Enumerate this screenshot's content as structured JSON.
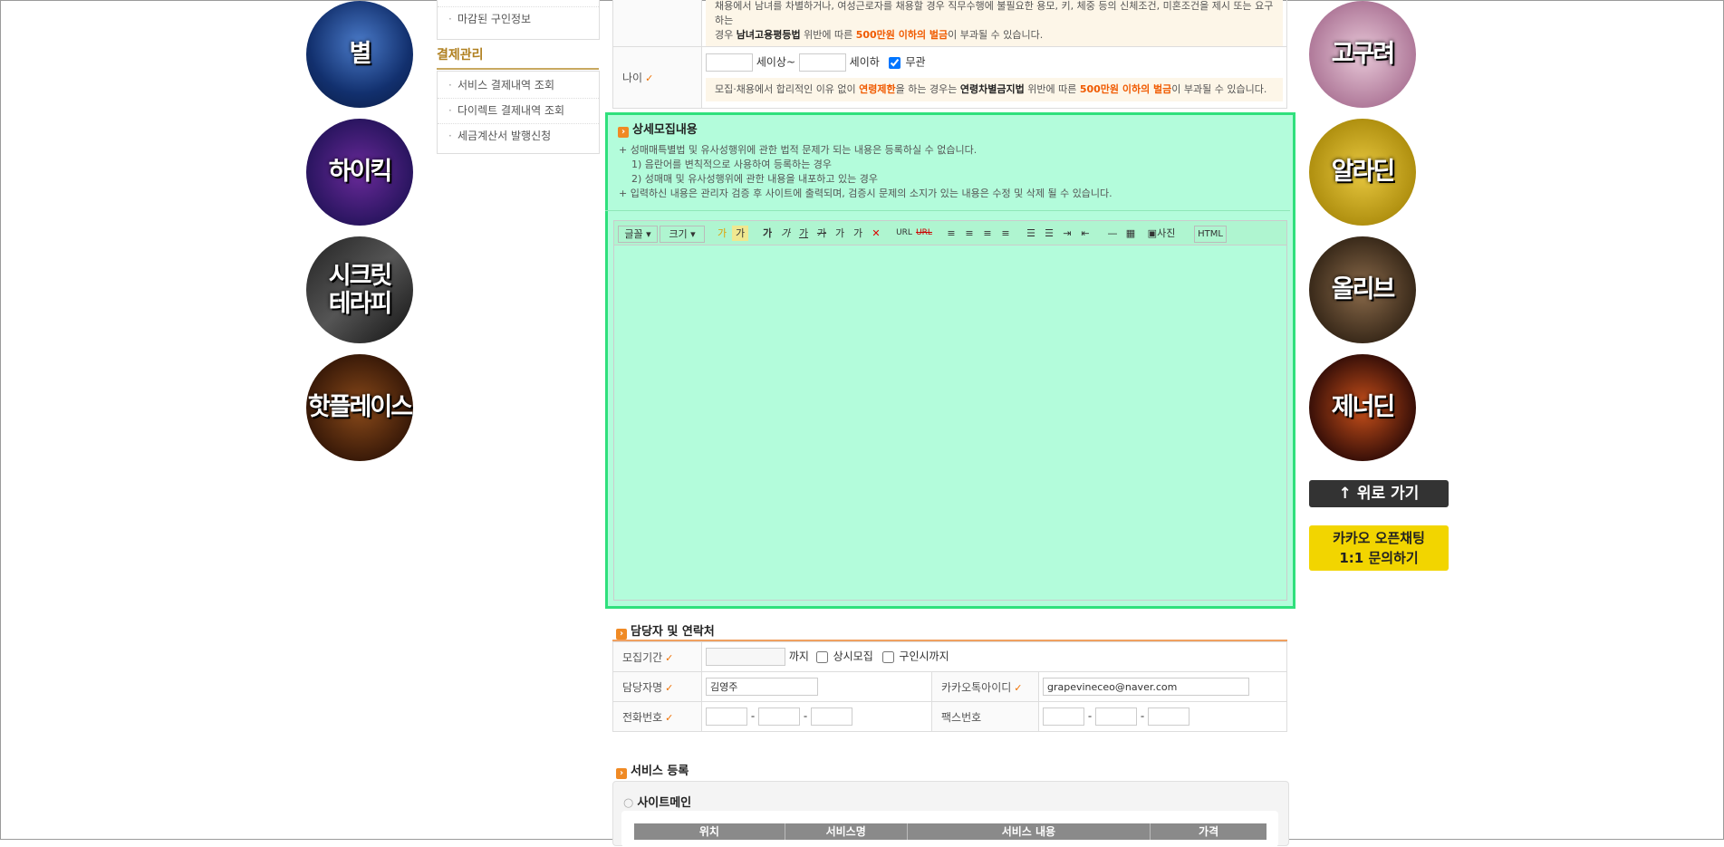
{
  "left_banners": [
    {
      "label": "별",
      "icon": "disco-ball-icon"
    },
    {
      "label": "하이킥",
      "icon": "balloon-icon"
    },
    {
      "label": "시크릿\n테라피",
      "icon": "massage-icon"
    },
    {
      "label": "핫플레이스",
      "icon": "bar-icon"
    }
  ],
  "right_banners": [
    {
      "label": "고구려",
      "icon": "champagne-tower-icon"
    },
    {
      "label": "알라딘",
      "icon": "wine-bottle-icon"
    },
    {
      "label": "올리브",
      "icon": "spa-icon"
    },
    {
      "label": "제너딘",
      "icon": "bokeh-light-icon"
    }
  ],
  "scroll_top_label": "↑ 위로 가기",
  "kakao_label_line1": "카카오 오픈채팅",
  "kakao_label_line2": "1:1 문의하기",
  "sidebar": {
    "closed_jobs": "마감된 구인정보",
    "payment_title": "결제관리",
    "payment_items": [
      "서비스 결제내역 조회",
      "다이렉트 결제내역 조회",
      "세금계산서 발행신청"
    ]
  },
  "gender_row": {
    "warn_line1": "채용에서 남녀를 차별하거나, 여성근로자를 채용할 경우 직무수행에 불필요한 용모, 키, 체중 등의 신체조건, 미혼조건을 제시 또는 요구하는",
    "warn_prefix": "경우",
    "law": "남녀고용평등법",
    "mid": "위반에 따른",
    "fine": "500만원 이하의 벌금",
    "suffix": "이 부과될 수 있습니다."
  },
  "age_row": {
    "label": "나이",
    "above": "세이상~",
    "below": "세이하",
    "any_label": "무관",
    "any_checked": true,
    "warn_prefix": "모집·채용에서 합리적인 이유 없이",
    "limit": "연령제한",
    "warn_mid": "을 하는 경우는",
    "law": "연령차별금지법",
    "mid2": "위반에 따른",
    "fine": "500만원 이하의 벌금",
    "suffix": "이 부과될 수 있습니다."
  },
  "detail": {
    "title": "상세모집내용",
    "notice": [
      "+ 성매매특별법 및 유사성행위에 관한 법적 문제가 되는 내용은 등록하실 수 없습니다.",
      "1) 음란어를 변칙적으로 사용하여 등록하는 경우",
      "2) 성매매 및 유사성행위에 관한 내용을 내포하고 있는 경우",
      "+ 입력하신 내용은 관리자 검증 후 사이트에 출력되며, 검증시 문제의 소지가 있는 내용은 수정 및 삭제 될 수 있습니다."
    ],
    "toolbar": {
      "font": "글꼴",
      "size": "크기",
      "photo": "사진",
      "html": "HTML",
      "url": "URL",
      "unurl": "URL",
      "ga1": "가",
      "ga2": "가",
      "b": "가",
      "i": "가",
      "u": "가",
      "s": "가",
      "sup": "가",
      "sub": "가"
    }
  },
  "contact": {
    "title": "담당자 및 연락처",
    "period_label": "모집기간",
    "until": "까지",
    "always_label": "상시모집",
    "until_hired_label": "구인시까지",
    "manager_label": "담당자명",
    "manager_value": "김영주",
    "kakao_label": "카카오톡아이디",
    "kakao_value": "grapevineceo@naver.com",
    "phone_label": "전화번호",
    "fax_label": "팩스번호",
    "dash": "-"
  },
  "service": {
    "title": "서비스 등록",
    "sub_title": "사이트메인",
    "columns": [
      "위치",
      "서비스명",
      "서비스 내용",
      "가격"
    ]
  },
  "colors": {
    "highlight_border": "#2fe07c",
    "highlight_bg": "#b3fcdb",
    "accent": "#f05a00",
    "gold": "#b08020"
  }
}
